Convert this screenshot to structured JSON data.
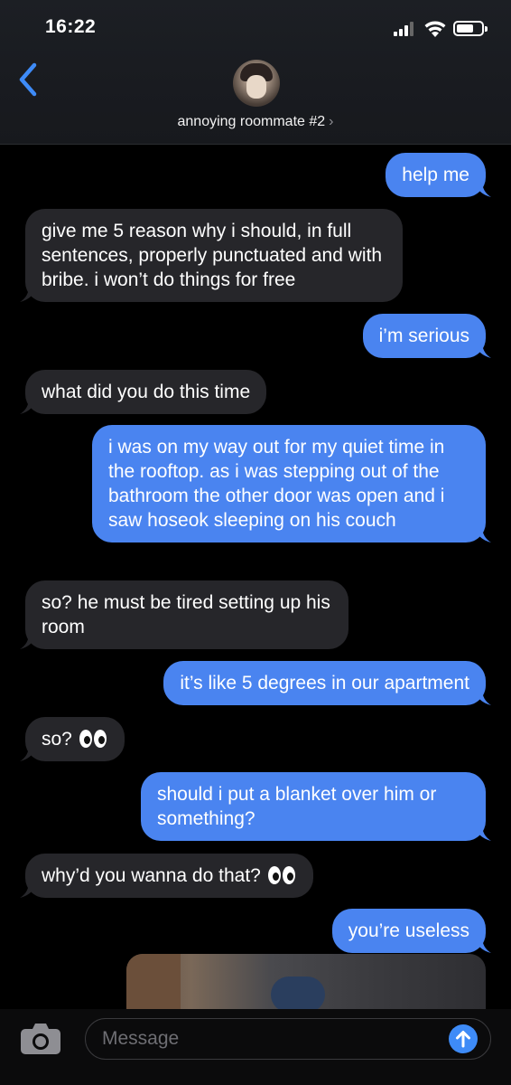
{
  "status_bar": {
    "time": "16:22"
  },
  "header": {
    "contact_name": "annoying roommate #2",
    "contact_chevron": "›"
  },
  "messages": [
    {
      "from": "me",
      "text": "help me"
    },
    {
      "from": "them",
      "text": "give me 5 reason why i should, in full sentences, properly punctuated and with bribe. i won’t do things for free"
    },
    {
      "from": "me",
      "text": "i’m serious"
    },
    {
      "from": "them",
      "text": "what did you do this time"
    },
    {
      "from": "me",
      "text": "i was on my way out for my quiet time in the rooftop. as i was stepping out of the bathroom the other door was open and i saw hoseok sleeping on his couch"
    },
    {
      "from": "them",
      "text": "so? he must be tired setting up his room"
    },
    {
      "from": "me",
      "text": "it’s like 5 degrees in our apartment"
    },
    {
      "from": "them",
      "text": "so?",
      "emoji": "eyes"
    },
    {
      "from": "me",
      "text": "should i put a blanket over him or something?"
    },
    {
      "from": "them",
      "text": "why’d you wanna do that?",
      "emoji": "eyes"
    },
    {
      "from": "me",
      "text": "you’re useless"
    },
    {
      "from": "me",
      "type": "photo"
    }
  ],
  "input": {
    "placeholder": "Message"
  },
  "icons": {
    "back": "chevron-left-icon",
    "camera": "camera-icon",
    "send": "arrow-up-icon",
    "signal": "signal-icon",
    "wifi": "wifi-icon",
    "battery": "battery-icon"
  },
  "colors": {
    "outgoing_bubble": "#4a84f0",
    "incoming_bubble": "#26262a",
    "accent": "#3e8bf7"
  }
}
